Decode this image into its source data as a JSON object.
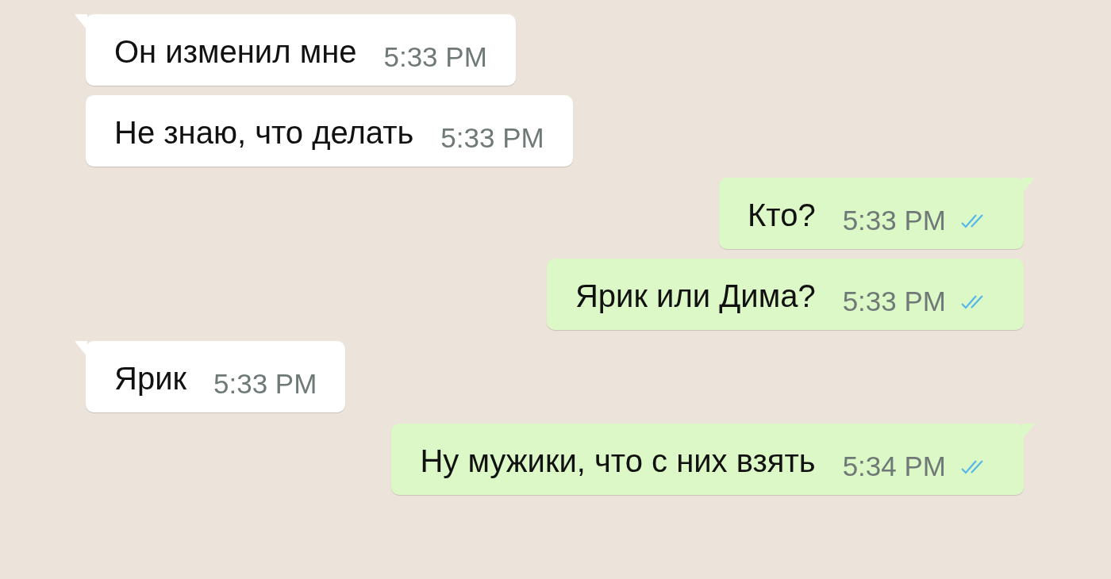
{
  "messages": [
    {
      "outgoing": false,
      "tail": true,
      "text": "Он изменил мне",
      "time": "5:33 PM"
    },
    {
      "outgoing": false,
      "tail": false,
      "text": "Не знаю, что делать",
      "time": "5:33 PM"
    },
    {
      "outgoing": true,
      "tail": true,
      "text": "Кто?",
      "time": "5:33 PM",
      "read": true
    },
    {
      "outgoing": true,
      "tail": false,
      "text": "Ярик или Дима?",
      "time": "5:33 PM",
      "read": true
    },
    {
      "outgoing": false,
      "tail": true,
      "text": "Ярик",
      "time": "5:33 PM"
    },
    {
      "outgoing": true,
      "tail": true,
      "text": "Ну мужики, что с них взять",
      "time": "5:34 PM",
      "read": true
    }
  ]
}
